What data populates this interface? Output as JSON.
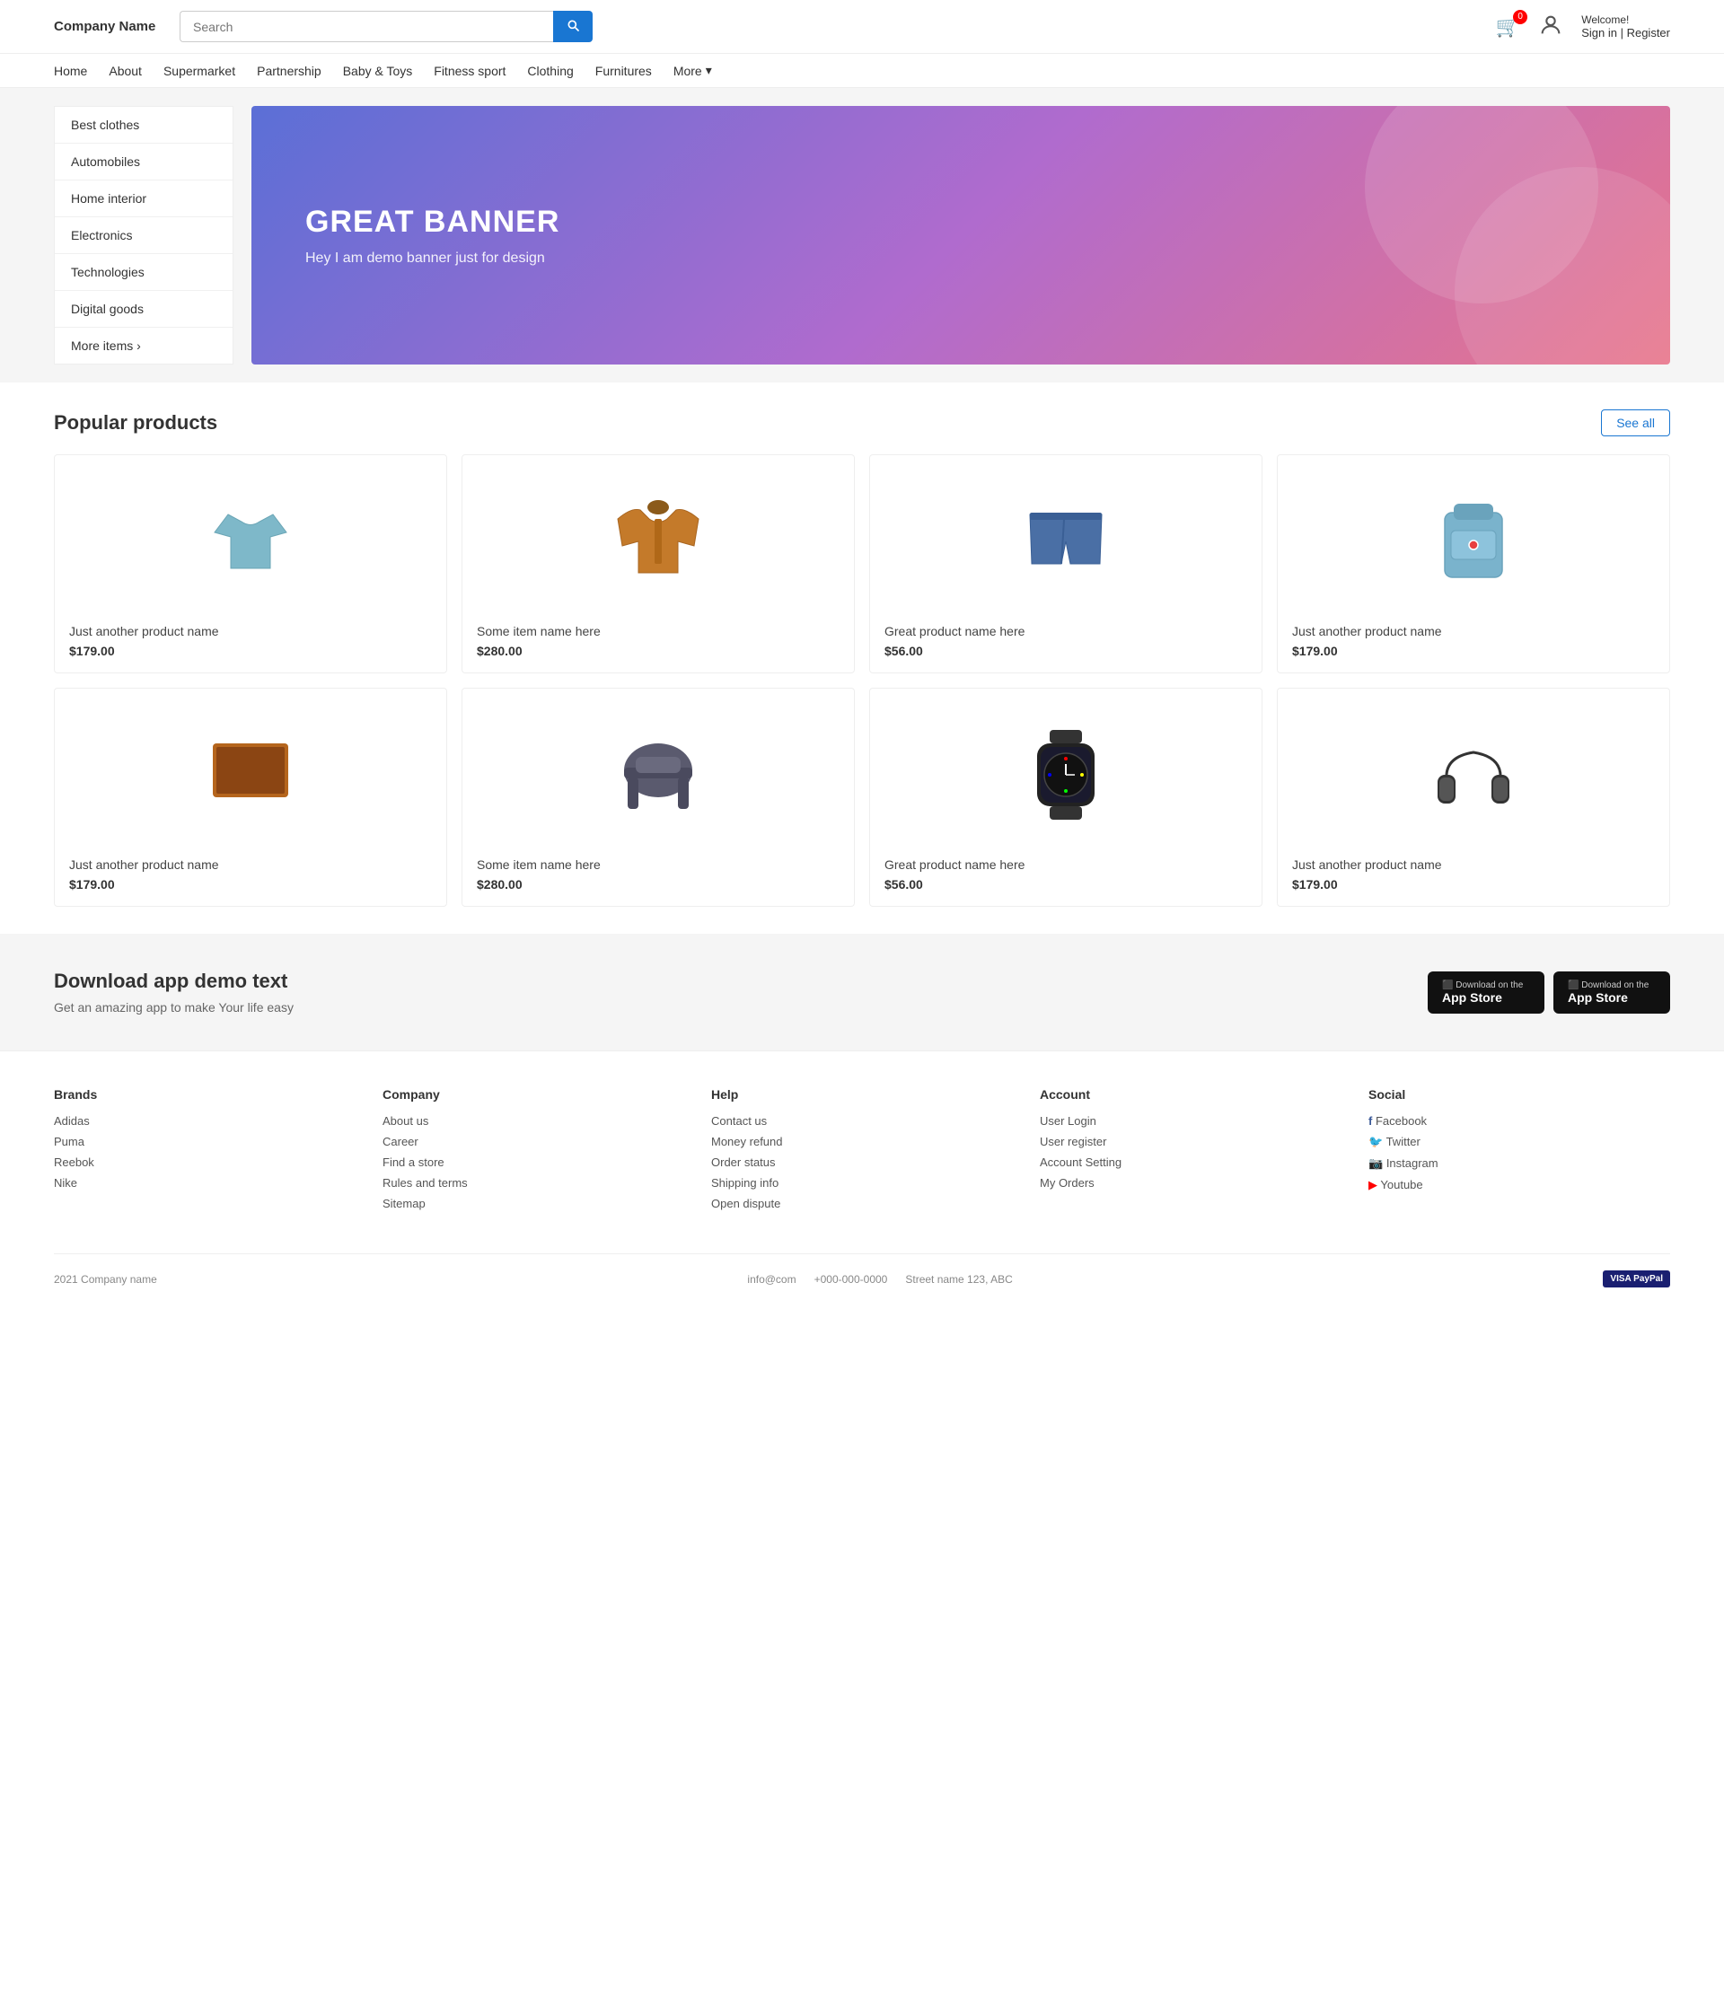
{
  "header": {
    "logo": "Company Name",
    "search_placeholder": "Search",
    "cart_count": "0",
    "welcome": "Welcome!",
    "sign_in": "Sign in",
    "register": "Register"
  },
  "nav": {
    "items": [
      {
        "label": "Home",
        "href": "#"
      },
      {
        "label": "About",
        "href": "#"
      },
      {
        "label": "Supermarket",
        "href": "#"
      },
      {
        "label": "Partnership",
        "href": "#"
      },
      {
        "label": "Baby &amp; Toys",
        "href": "#"
      },
      {
        "label": "Fitness sport",
        "href": "#"
      },
      {
        "label": "Clothing",
        "href": "#"
      },
      {
        "label": "Furnitures",
        "href": "#"
      },
      {
        "label": "More",
        "href": "#"
      }
    ]
  },
  "sidebar": {
    "items": [
      "Best clothes",
      "Automobiles",
      "Home interior",
      "Electronics",
      "Technologies",
      "Digital goods",
      "More items"
    ]
  },
  "banner": {
    "title": "GREAT BANNER",
    "subtitle": "Hey I am demo banner just for design"
  },
  "products": {
    "section_title": "Popular products",
    "see_all": "See all",
    "items": [
      {
        "name": "Just another product name",
        "price": "$179.00",
        "type": "tshirt"
      },
      {
        "name": "Some item name here",
        "price": "$280.00",
        "type": "jacket"
      },
      {
        "name": "Great product name here",
        "price": "$56.00",
        "type": "shorts"
      },
      {
        "name": "Just another product name",
        "price": "$179.00",
        "type": "backpack"
      },
      {
        "name": "Just another product name",
        "price": "$179.00",
        "type": "laptop"
      },
      {
        "name": "Some item name here",
        "price": "$280.00",
        "type": "chair"
      },
      {
        "name": "Great product name here",
        "price": "$56.00",
        "type": "watch"
      },
      {
        "name": "Just another product name",
        "price": "$179.00",
        "type": "headphones"
      }
    ]
  },
  "app_section": {
    "title": "Download app demo text",
    "subtitle": "Get an amazing app to make Your life easy",
    "btn1_small": "Download on the",
    "btn1_big": "App Store",
    "btn2_small": "Download on the",
    "btn2_big": "App Store"
  },
  "footer": {
    "brands": {
      "title": "Brands",
      "items": [
        "Adidas",
        "Puma",
        "Reebok",
        "Nike"
      ]
    },
    "company": {
      "title": "Company",
      "items": [
        "About us",
        "Career",
        "Find a store",
        "Rules and terms",
        "Sitemap"
      ]
    },
    "help": {
      "title": "Help",
      "items": [
        "Contact us",
        "Money refund",
        "Order status",
        "Shipping info",
        "Open dispute"
      ]
    },
    "account": {
      "title": "Account",
      "items": [
        "User Login",
        "User register",
        "Account Setting",
        "My Orders"
      ]
    },
    "social": {
      "title": "Social",
      "items": [
        {
          "label": "Facebook",
          "icon": "f"
        },
        {
          "label": "Twitter",
          "icon": "t"
        },
        {
          "label": "Instagram",
          "icon": "i"
        },
        {
          "label": "Youtube",
          "icon": "y"
        }
      ]
    },
    "bottom": {
      "copyright": "2021 Company name",
      "email": "info@com",
      "phone": "+000-000-0000",
      "address": "Street name 123, ABC"
    }
  }
}
